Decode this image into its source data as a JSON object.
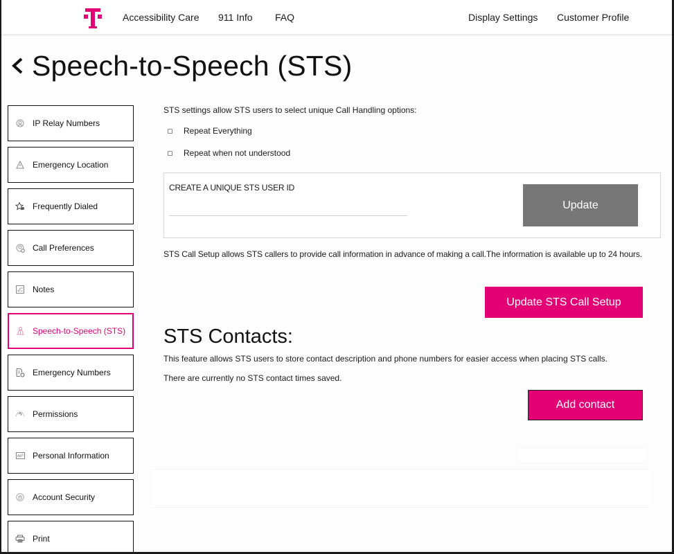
{
  "colors": {
    "brand": "#e20074",
    "update_button": "#767676",
    "text": "#111111"
  },
  "header": {
    "logo": "t-mobile-logo",
    "nav_left": [
      {
        "label": "Accessibility Care"
      },
      {
        "label": "911 Info"
      },
      {
        "label": "FAQ"
      }
    ],
    "nav_right": [
      {
        "label": "Display Settings"
      },
      {
        "label": "Customer Profile"
      }
    ]
  },
  "page": {
    "back_icon": "chevron-left-icon",
    "title": "Speech-to-Speech (STS)"
  },
  "sidebar": {
    "items": [
      {
        "label": "IP Relay Numbers",
        "icon": "user-circle-icon",
        "active": false
      },
      {
        "label": "Emergency Location",
        "icon": "warning-triangle-icon",
        "active": false
      },
      {
        "label": "Frequently Dialed",
        "icon": "star-icon",
        "active": false
      },
      {
        "label": "Call Preferences",
        "icon": "user-clock-icon",
        "active": false
      },
      {
        "label": "Notes",
        "icon": "notes-icon",
        "active": false
      },
      {
        "label": "Speech-to-Speech (STS)",
        "icon": "people-icon",
        "active": true
      },
      {
        "label": "Emergency Numbers",
        "icon": "document-gear-icon",
        "active": false
      },
      {
        "label": "Permissions",
        "icon": "handshake-icon",
        "active": false
      },
      {
        "label": "Personal Information",
        "icon": "id-card-icon",
        "active": false
      },
      {
        "label": "Account Security",
        "icon": "lock-circle-icon",
        "active": false
      },
      {
        "label": "Print",
        "icon": "printer-icon",
        "active": false
      }
    ]
  },
  "sts_settings": {
    "intro": "STS settings allow STS users to select unique Call Handling options:",
    "options": [
      {
        "label": "Repeat Everything",
        "checked": false
      },
      {
        "label": "Repeat when not understood",
        "checked": false
      }
    ]
  },
  "user_id": {
    "label": "CREATE A UNIQUE STS USER ID",
    "value": "",
    "placeholder": "",
    "button_label": "Update"
  },
  "call_setup": {
    "description": "STS Call Setup allows STS callers to provide call information in advance of making a call.The information is available up to 24 hours.",
    "button_label": "Update STS Call Setup"
  },
  "contacts": {
    "title": "STS Contacts:",
    "description": "This feature allows STS users to store contact description and phone numbers for easier access when placing STS calls.",
    "empty_message": "There are currently no STS contact times saved.",
    "button_label": "Add contact"
  }
}
